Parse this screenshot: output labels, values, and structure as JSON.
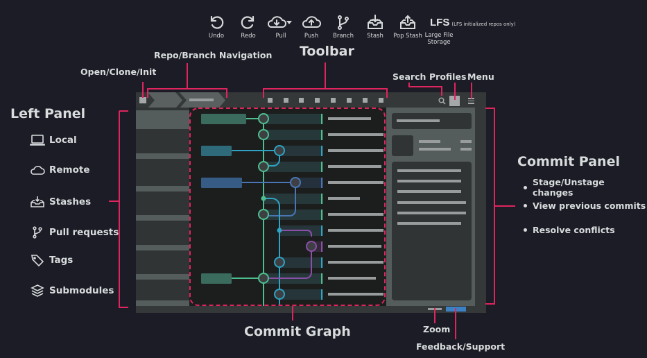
{
  "toolbar_icons": [
    {
      "label": "Undo",
      "icon": "undo-icon"
    },
    {
      "label": "Redo",
      "icon": "redo-icon"
    },
    {
      "label": "Pull",
      "icon": "pull-icon"
    },
    {
      "label": "Push",
      "icon": "push-icon"
    },
    {
      "label": "Branch",
      "icon": "branch-icon"
    },
    {
      "label": "Stash",
      "icon": "stash-icon"
    },
    {
      "label": "Pop Stash",
      "icon": "pop-stash-icon"
    },
    {
      "label": "Large File Storage",
      "icon": "lfs-icon"
    }
  ],
  "lfs": {
    "text": "LFS",
    "note": "(LFS initialized repos only)",
    "caption_1": "Large File",
    "caption_2": "Storage"
  },
  "annotations": {
    "toolbar": "Toolbar",
    "repo_nav": "Repo/Branch Navigation",
    "open_clone": "Open/Clone/Init",
    "search": "Search",
    "profiles": "Profiles",
    "menu": "Menu",
    "left_panel": "Left Panel",
    "commit_panel": "Commit Panel",
    "commit_graph": "Commit Graph",
    "zoom": "Zoom",
    "feedback": "Feedback/Support"
  },
  "left_panel_items": [
    {
      "label": "Local",
      "icon": "laptop-icon"
    },
    {
      "label": "Remote",
      "icon": "cloud-icon"
    },
    {
      "label": "Stashes",
      "icon": "stash-icon"
    },
    {
      "label": "Pull requests",
      "icon": "pull-request-icon"
    },
    {
      "label": "Tags",
      "icon": "tag-icon"
    },
    {
      "label": "Submodules",
      "icon": "layers-icon"
    }
  ],
  "commit_panel_features": [
    "Stage/Unstage changes",
    "View previous commits",
    "Resolve conflicts"
  ],
  "colors": {
    "accent_pink": "#e0245e",
    "branch_green": "#4dbf8e",
    "branch_cyan": "#2ea3c4",
    "branch_blue": "#4a76b8",
    "branch_purple": "#8a4fa6",
    "feedback_blue": "#3b82c4"
  }
}
